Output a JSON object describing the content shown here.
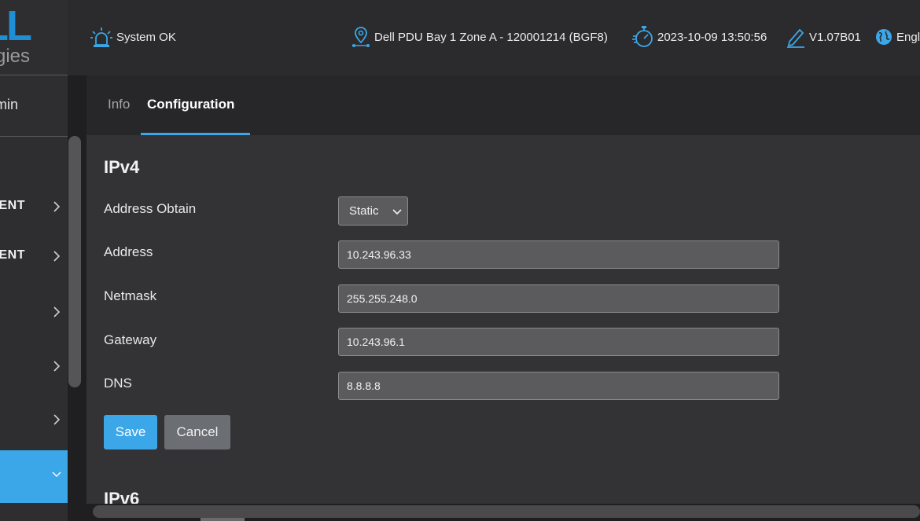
{
  "sidebar": {
    "logo_big": "LL",
    "logo_small": "gies",
    "user_name": "min",
    "items": [
      {
        "label": "ENT",
        "icon": "chevron-right-icon"
      },
      {
        "label": "ENT",
        "icon": "chevron-right-icon"
      },
      {
        "label": "",
        "icon": "chevron-right-icon"
      },
      {
        "label": "",
        "icon": "chevron-right-icon"
      },
      {
        "label": "",
        "icon": "chevron-right-icon"
      }
    ],
    "active_item": {
      "label": "",
      "icon": "chevron-down-icon"
    }
  },
  "header": {
    "status": "System OK",
    "location": "Dell PDU Bay 1 Zone A - 120001214 (BGF8)",
    "datetime": "2023-10-09 13:50:56",
    "version": "V1.07B01",
    "language": "Engl"
  },
  "tabs": [
    {
      "label": "Info",
      "active": false
    },
    {
      "label": "Configuration",
      "active": true
    }
  ],
  "ipv4": {
    "title": "IPv4",
    "address_obtain_label": "Address Obtain",
    "address_obtain_value": "Static",
    "address_label": "Address",
    "address_value": "10.243.96.33",
    "netmask_label": "Netmask",
    "netmask_value": "255.255.248.0",
    "gateway_label": "Gateway",
    "gateway_value": "10.243.96.1",
    "dns_label": "DNS",
    "dns_value": "8.8.8.8",
    "save_label": "Save",
    "cancel_label": "Cancel"
  },
  "ipv6": {
    "title": "IPv6"
  },
  "colors": {
    "accent": "#3ba7e8",
    "background": "#333335",
    "header_bg": "#2b2b2d"
  }
}
